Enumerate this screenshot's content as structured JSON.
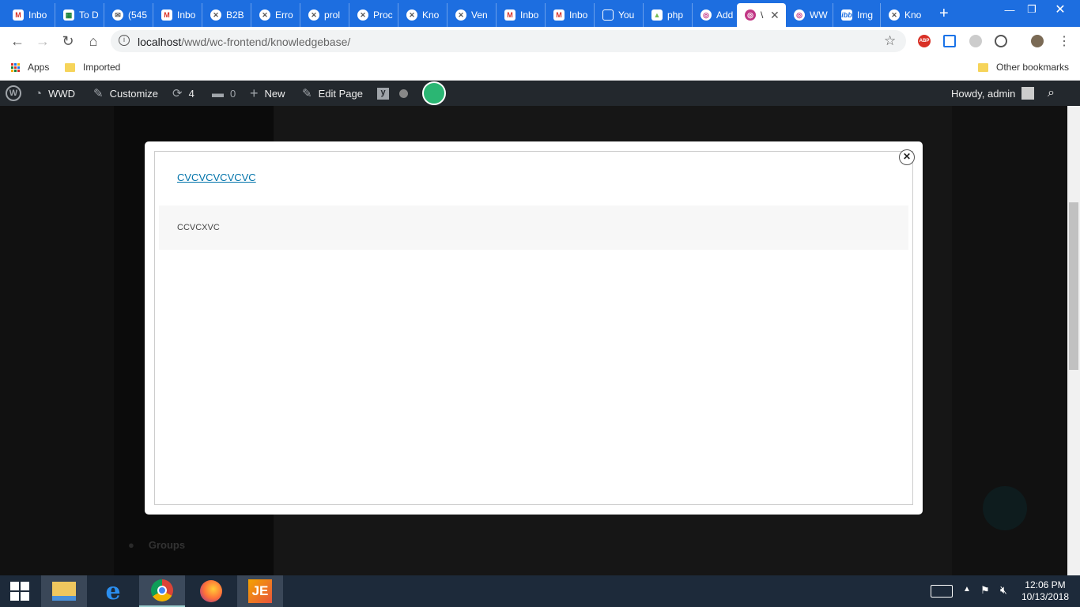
{
  "browser": {
    "tabs": [
      {
        "title": "Inbo",
        "icon": "gmail-icon"
      },
      {
        "title": "To D",
        "icon": "sheets-icon"
      },
      {
        "title": "(545",
        "icon": "mail-icon"
      },
      {
        "title": "Inbo",
        "icon": "gmail-icon"
      },
      {
        "title": "B2B",
        "icon": "wordpress-icon"
      },
      {
        "title": "Erro",
        "icon": "wordpress-icon"
      },
      {
        "title": "prol",
        "icon": "wordpress-icon"
      },
      {
        "title": "Proc",
        "icon": "wordpress-icon"
      },
      {
        "title": "Kno",
        "icon": "wordpress-icon"
      },
      {
        "title": "Ven",
        "icon": "wordpress-icon"
      },
      {
        "title": "Inbo",
        "icon": "gmail-icon"
      },
      {
        "title": "Inbo",
        "icon": "gmail-icon"
      },
      {
        "title": "You",
        "icon": "document-icon"
      },
      {
        "title": "php",
        "icon": "php-icon"
      },
      {
        "title": "Add",
        "icon": "instagram-icon"
      },
      {
        "title": "\\",
        "icon": "instagram-icon"
      },
      {
        "title": "WW",
        "icon": "instagram-icon"
      },
      {
        "title": "Img",
        "icon": "imgbb-icon"
      },
      {
        "title": "Kno",
        "icon": "wordpress-icon"
      }
    ],
    "active_tab_index": 15,
    "url_host": "localhost",
    "url_path": "/wwd/wc-frontend/knowledgebase/",
    "bookmarks": [
      {
        "label": "Apps",
        "icon": "apps-grid-icon"
      },
      {
        "label": "Imported",
        "icon": "folder-icon"
      }
    ],
    "other_bookmarks": "Other bookmarks"
  },
  "admin_bar": {
    "site_name": "WWD",
    "customize": "Customize",
    "updates_count": "4",
    "comments_count": "0",
    "new_label": "New",
    "edit_page": "Edit Page",
    "howdy": "Howdy, admin"
  },
  "sidebar": {
    "items": [
      "Groups"
    ]
  },
  "modal": {
    "title": "CVCVCVCVCVC",
    "body": "CCVCXVC"
  },
  "taskbar": {
    "time": "12:06 PM",
    "date": "10/13/2018"
  },
  "colors": {
    "tab_strip": "#1d6ee0",
    "admin_bar": "#23282d",
    "link": "#0073aa",
    "taskbar": "#1d2a3a"
  }
}
